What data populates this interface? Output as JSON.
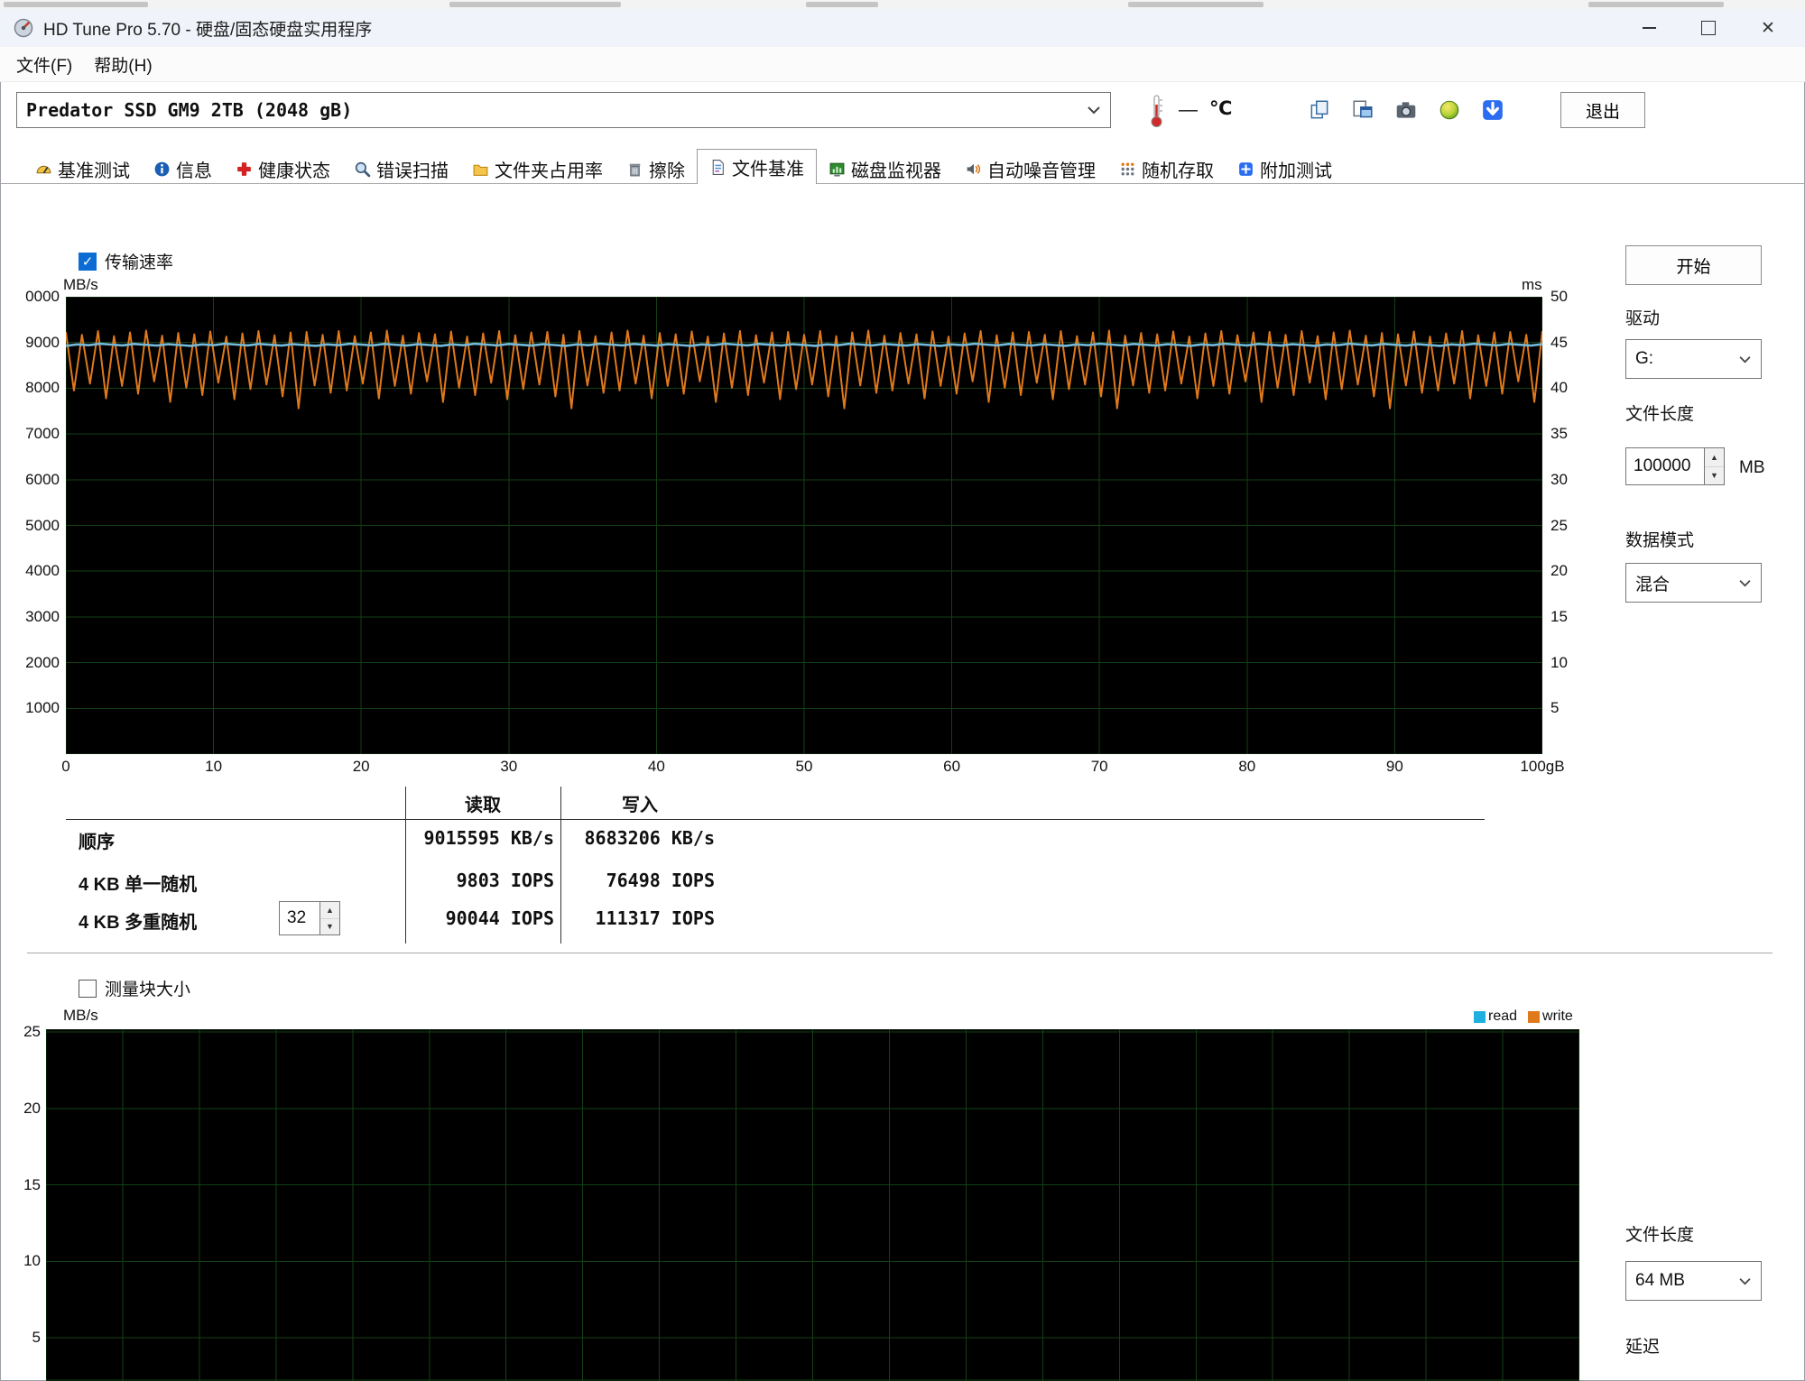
{
  "window": {
    "title": "HD Tune Pro 5.70 - 硬盘/固态硬盘实用程序",
    "controls": [
      "minimize",
      "maximize",
      "close"
    ]
  },
  "menu": {
    "file": "文件(F)",
    "help": "帮助(H)"
  },
  "toolbar": {
    "drive_selector": "Predator SSD GM9 2TB (2048 gB)",
    "temp_value": "—",
    "temp_unit": "℃",
    "exit_label": "退出",
    "icon_buttons": [
      "copy-icon",
      "copy-report-icon",
      "camera-icon",
      "palette-icon",
      "download-icon"
    ]
  },
  "tabs": {
    "selected": "文件基准",
    "items": [
      {
        "label": "基准测试",
        "icon": "benchmark-icon"
      },
      {
        "label": "信息",
        "icon": "info-icon"
      },
      {
        "label": "健康状态",
        "icon": "health-icon"
      },
      {
        "label": "错误扫描",
        "icon": "error-scan-icon"
      },
      {
        "label": "文件夹占用率",
        "icon": "folder-usage-icon"
      },
      {
        "label": "擦除",
        "icon": "erase-icon"
      },
      {
        "label": "文件基准",
        "icon": "file-benchmark-icon"
      },
      {
        "label": "磁盘监视器",
        "icon": "disk-monitor-icon"
      },
      {
        "label": "自动噪音管理",
        "icon": "aam-icon"
      },
      {
        "label": "随机存取",
        "icon": "random-access-icon"
      },
      {
        "label": "附加测试",
        "icon": "extra-tests-icon"
      }
    ]
  },
  "file_benchmark": {
    "transfer_checkbox": "传输速率",
    "start_button": "开始",
    "drive_label": "驱动",
    "drive_value": "G:",
    "file_length_label": "文件长度",
    "file_length_value": "100000",
    "file_length_unit": "MB",
    "data_mode_label": "数据模式",
    "data_mode_value": "混合",
    "results": {
      "col_read": "读取",
      "col_write": "写入",
      "rows": [
        {
          "label": "顺序",
          "read": "9015595 KB/s",
          "write": "8683206 KB/s"
        },
        {
          "label": "4 KB 单一随机",
          "read": "9803 IOPS",
          "write": "76498 IOPS"
        },
        {
          "label": "4 KB 多重随机",
          "queue_depth": "32",
          "read": "90044 IOPS",
          "write": "111317 IOPS"
        }
      ]
    }
  },
  "block_section": {
    "checkbox": "测量块大小",
    "legend_read": "read",
    "legend_write": "write",
    "legend_read_color": "#1fb0e0",
    "legend_write_color": "#e0791c",
    "file_length_label": "文件长度",
    "file_length_value": "64 MB",
    "latency_label": "延迟"
  },
  "chart_data": [
    {
      "type": "line",
      "title": "传输速率",
      "y_left_label": "MB/s",
      "y_right_label": "ms",
      "x_ticks": [
        "0",
        "10",
        "20",
        "30",
        "40",
        "50",
        "60",
        "70",
        "80",
        "90",
        "100gB"
      ],
      "y_left_ticks": [
        "0000",
        "9000",
        "8000",
        "7000",
        "6000",
        "5000",
        "4000",
        "3000",
        "2000",
        "1000"
      ],
      "y_right_ticks": [
        "50",
        "45",
        "40",
        "35",
        "30",
        "25",
        "20",
        "15",
        "10",
        "5"
      ],
      "x_range": [
        0,
        100
      ],
      "y_left_range": [
        0,
        10000
      ],
      "grid": {
        "cols": 10,
        "rows": 10,
        "color": "#134013",
        "background": "#000000"
      },
      "series": [
        {
          "name": "write-speed",
          "color": "#e0791c",
          "style": "zigzag",
          "cycles": 92,
          "peaks": [
            9230,
            9170,
            9250,
            9140,
            9220,
            9260,
            9150,
            9210,
            9180,
            9240,
            9130,
            9200,
            9250,
            9160,
            9220
          ],
          "troughs": [
            7950,
            8100,
            7780,
            8050,
            7880,
            8150,
            7700,
            8010,
            7850,
            8120,
            7760,
            7980,
            8080,
            7820,
            7560,
            8060,
            7900
          ]
        },
        {
          "name": "read-speed",
          "color": "#74b9d8",
          "style": "flat",
          "value": 8950,
          "wiggle": 22
        }
      ]
    },
    {
      "type": "line",
      "title": "测量块大小",
      "y_left_label": "MB/s",
      "y_left_ticks": [
        "25",
        "20",
        "15",
        "10",
        "5"
      ],
      "y_left_values": [
        25,
        20,
        15,
        10,
        5
      ],
      "grid": {
        "cols": 20,
        "color": "#134013",
        "background": "#000000"
      },
      "series": []
    }
  ]
}
